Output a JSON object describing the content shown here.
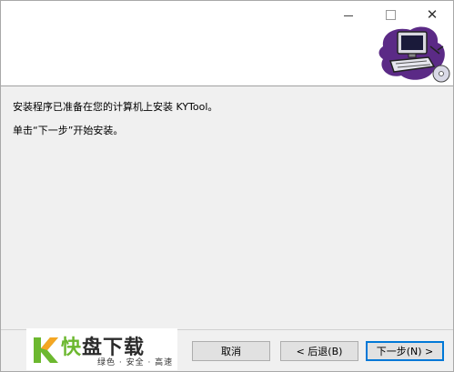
{
  "window": {
    "controls": {
      "minimize_icon": "minimize-icon",
      "maximize_icon": "maximize-icon",
      "close_icon": "close-icon",
      "close_glyph": "✕"
    }
  },
  "header": {
    "graphic_icon": "computer-install-icon"
  },
  "content": {
    "line1": "安装程序已准备在您的计算机上安装 KYTool。",
    "line2": "单击“下一步”开始安装。"
  },
  "buttons": {
    "cancel": "取消",
    "back": "< 后退(B)",
    "next": "下一步(N) >"
  },
  "watermark": {
    "title_first": "快",
    "title_rest": "盘下载",
    "slogan": "绿色 · 安全 · 高速",
    "accent": "#6cb82f",
    "logo_accent": "#f5a623"
  }
}
